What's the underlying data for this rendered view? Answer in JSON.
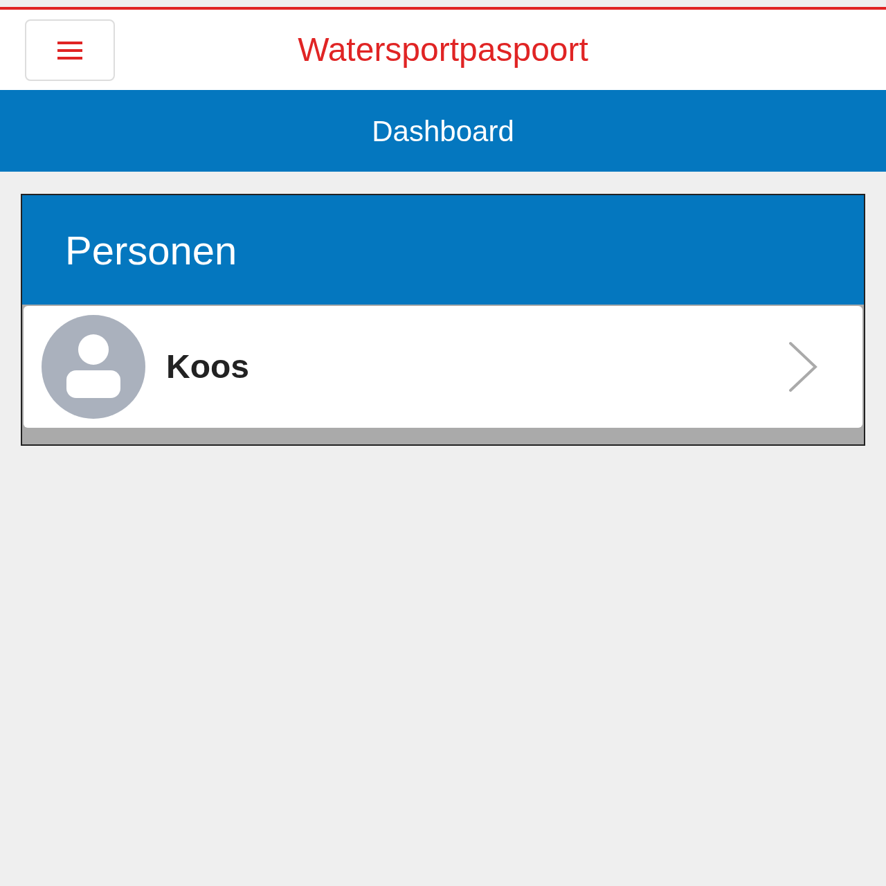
{
  "header": {
    "title": "Watersportpaspoort"
  },
  "nav_bar": {
    "title": "Dashboard"
  },
  "card": {
    "title": "Personen",
    "persons": [
      {
        "name": "Koos"
      }
    ]
  }
}
